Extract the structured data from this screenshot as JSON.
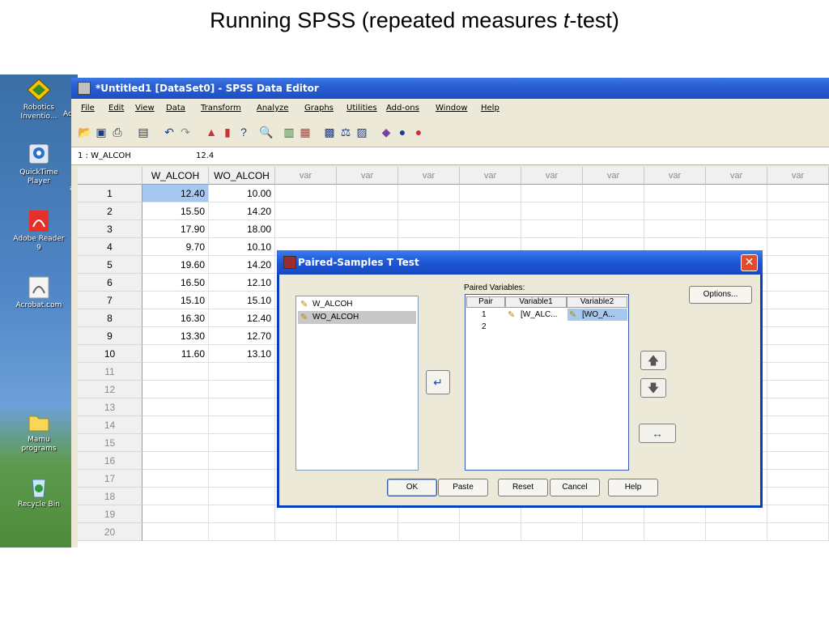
{
  "slide": {
    "title_main": "Running SPSS (repeated measures ",
    "title_italic": "t",
    "title_end": "-test)"
  },
  "desktop": {
    "icons": [
      {
        "label": "Robotics\nInventio...",
        "name": "robotics-inventions-icon"
      },
      {
        "label": "QuickTime\nPlayer",
        "name": "quicktime-player-icon"
      },
      {
        "label": "Adobe Reader\n9",
        "name": "adobe-reader-icon"
      },
      {
        "label": "Acrobat.com",
        "name": "acrobat-com-icon"
      },
      {
        "label": "Mamu\nprograms",
        "name": "folder-icon"
      },
      {
        "label": "Recycle Bin",
        "name": "recycle-bin-icon"
      }
    ],
    "side_labels": [
      "Ac",
      "E",
      "al"
    ]
  },
  "window": {
    "title": "*Untitled1 [DataSet0] - SPSS Data Editor",
    "menu": [
      "File",
      "Edit",
      "View",
      "Data",
      "Transform",
      "Analyze",
      "Graphs",
      "Utilities",
      "Add-ons",
      "Window",
      "Help"
    ],
    "cell_ref": "1 : W_ALCOH",
    "cell_value": "12.4"
  },
  "grid": {
    "columns": [
      "W_ALCOH",
      "WO_ALCOH",
      "var",
      "var",
      "var",
      "var",
      "var",
      "var",
      "var",
      "var",
      "var"
    ],
    "rows": [
      [
        "12.40",
        "10.00"
      ],
      [
        "15.50",
        "14.20"
      ],
      [
        "17.90",
        "18.00"
      ],
      [
        "9.70",
        "10.10"
      ],
      [
        "19.60",
        "14.20"
      ],
      [
        "16.50",
        "12.10"
      ],
      [
        "15.10",
        "15.10"
      ],
      [
        "16.30",
        "12.40"
      ],
      [
        "13.30",
        "12.70"
      ],
      [
        "11.60",
        "13.10"
      ]
    ],
    "row_numbers": [
      "1",
      "2",
      "3",
      "4",
      "5",
      "6",
      "7",
      "8",
      "9",
      "10",
      "11",
      "12",
      "13",
      "14",
      "15",
      "16",
      "17",
      "18",
      "19",
      "20"
    ]
  },
  "dialog": {
    "title": "Paired-Samples T Test",
    "source_vars": [
      "W_ALCOH",
      "WO_ALCOH"
    ],
    "paired_label": "Paired Variables:",
    "table_headers": [
      "Pair",
      "Variable1",
      "Variable2"
    ],
    "pairs": [
      {
        "pair": "1",
        "var1": "[W_ALC...",
        "var2": "[WO_A..."
      },
      {
        "pair": "2",
        "var1": "",
        "var2": ""
      }
    ],
    "buttons": {
      "options": "Options...",
      "ok": "OK",
      "paste": "Paste",
      "reset": "Reset",
      "cancel": "Cancel",
      "help": "Help"
    }
  }
}
